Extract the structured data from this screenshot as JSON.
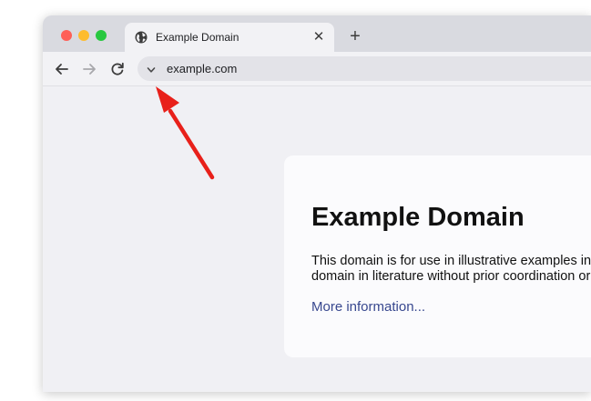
{
  "window_controls": [
    "close",
    "minimize",
    "maximize"
  ],
  "tab": {
    "title": "Example Domain",
    "icon": "globe-icon",
    "close_glyph": "✕"
  },
  "new_tab_glyph": "+",
  "toolbar": {
    "back_icon": "arrow-left-icon",
    "forward_icon": "arrow-right-icon",
    "reload_icon": "reload-icon"
  },
  "urlbar": {
    "url": "example.com",
    "icon": "chevron-down-icon"
  },
  "page": {
    "heading": "Example Domain",
    "paragraph_lines": [
      "This domain is for use in illustrative examples in documents. You may use this",
      "domain in literature without prior coordination or asking for permission."
    ],
    "link": "More information..."
  },
  "annotation": {
    "type": "arrow",
    "color": "#e8201a"
  },
  "colors": {
    "link": "#38488f",
    "arrow": "#e8201a",
    "traffic_red": "#fe5f57",
    "traffic_yellow": "#febc2e",
    "traffic_green": "#28c840"
  }
}
